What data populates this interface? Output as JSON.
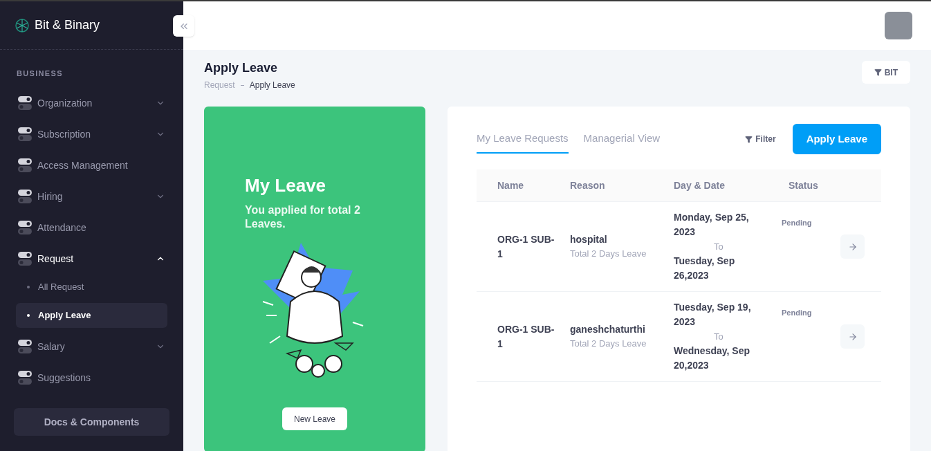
{
  "brand": {
    "name": "Bit & Binary"
  },
  "sidebar": {
    "section": "BUSINESS",
    "items": [
      {
        "label": "Organization",
        "kind": "group",
        "expanded": false,
        "selected": false
      },
      {
        "label": "Subscription",
        "kind": "group",
        "expanded": false,
        "selected": false
      },
      {
        "label": "Access Management",
        "kind": "link",
        "selected": false
      },
      {
        "label": "Hiring",
        "kind": "group",
        "expanded": false,
        "selected": false
      },
      {
        "label": "Attendance",
        "kind": "link",
        "selected": false
      },
      {
        "label": "Request",
        "kind": "group",
        "expanded": true,
        "selected": true,
        "children": [
          {
            "label": "All Request",
            "selected": false
          },
          {
            "label": "Apply Leave",
            "selected": true
          }
        ]
      },
      {
        "label": "Salary",
        "kind": "group",
        "expanded": false,
        "selected": false
      },
      {
        "label": "Suggestions",
        "kind": "link",
        "selected": false
      }
    ],
    "footer_button": "Docs & Components"
  },
  "page": {
    "title": "Apply Leave",
    "breadcrumb": [
      "Request",
      "Apply Leave"
    ],
    "filter_button": "BIT"
  },
  "leave_card": {
    "title": "My Leave",
    "subtitle": "You applied for total 2 Leaves.",
    "button": "New Leave"
  },
  "requests": {
    "tabs": [
      {
        "label": "My Leave Requests",
        "selected": true
      },
      {
        "label": "Managerial View",
        "selected": false
      }
    ],
    "filter": "Filter",
    "apply_button": "Apply Leave",
    "columns": [
      "Name",
      "Reason",
      "Day & Date",
      "Status"
    ],
    "rows": [
      {
        "name": "ORG-1 SUB-1",
        "reason": "hospital",
        "duration": "Total 2 Days Leave",
        "from": "Monday, Sep 25, 2023",
        "to_label": "To",
        "to": "Tuesday, Sep 26,2023",
        "status": "Pending"
      },
      {
        "name": "ORG-1 SUB-1",
        "reason": "ganeshchaturthi",
        "duration": "Total 2 Days Leave",
        "from": "Tuesday, Sep 19, 2023",
        "to_label": "To",
        "to": "Wednesday, Sep 20,2023",
        "status": "Pending"
      }
    ]
  }
}
